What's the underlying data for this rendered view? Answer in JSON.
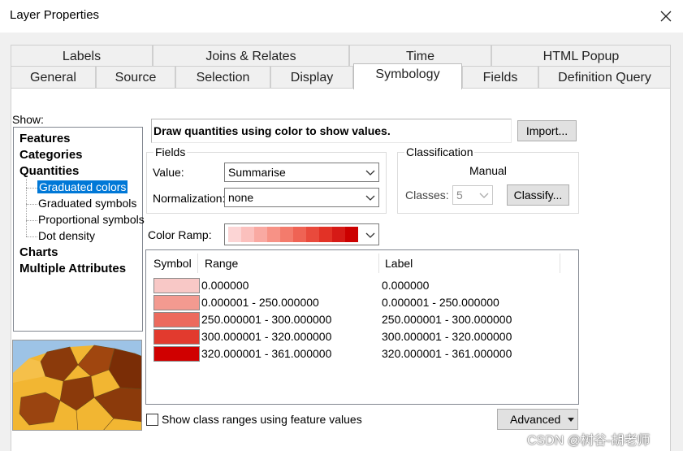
{
  "window": {
    "title": "Layer Properties"
  },
  "tabs_top": [
    "Labels",
    "Joins & Relates",
    "Time",
    "HTML Popup"
  ],
  "tabs_bottom": [
    "General",
    "Source",
    "Selection",
    "Display",
    "Symbology",
    "Fields",
    "Definition Query"
  ],
  "active_tab": "Symbology",
  "show": {
    "label": "Show:",
    "tree": {
      "features": "Features",
      "categories": "Categories",
      "quantities": "Quantities",
      "sub": [
        "Graduated colors",
        "Graduated symbols",
        "Proportional symbols",
        "Dot density"
      ],
      "charts": "Charts",
      "multiple": "Multiple Attributes"
    },
    "selected": "Graduated colors"
  },
  "description": "Draw quantities using color to show values.",
  "import_button": "Import...",
  "fields": {
    "group_title": "Fields",
    "value_label": "Value:",
    "value": "Summarise",
    "normalization_label": "Normalization:",
    "normalization": "none"
  },
  "classification": {
    "group_title": "Classification",
    "method": "Manual",
    "classes_label": "Classes:",
    "classes": "5",
    "classify_button": "Classify..."
  },
  "color_ramp": {
    "label": "Color Ramp:",
    "colors": [
      "#fcd5d5",
      "#fbc0bd",
      "#f9a9a2",
      "#f79286",
      "#f37b6c",
      "#ef6354",
      "#e94a3c",
      "#e23226",
      "#d61a16",
      "#cc0000"
    ]
  },
  "class_table": {
    "headers": {
      "symbol": "Symbol",
      "range": "Range",
      "label": "Label"
    },
    "rows": [
      {
        "color": "#f8c8c6",
        "range": "0.000000",
        "label": "0.000000"
      },
      {
        "color": "#f39a90",
        "range": "0.000001 - 250.000000",
        "label": "0.000001 - 250.000000"
      },
      {
        "color": "#ec6a5d",
        "range": "250.000001 - 300.000000",
        "label": "250.000001 - 300.000000"
      },
      {
        "color": "#e23a2e",
        "range": "300.000001 - 320.000000",
        "label": "300.000001 - 320.000000"
      },
      {
        "color": "#d00000",
        "range": "320.000001 - 361.000000",
        "label": "320.000001 - 361.000000"
      }
    ]
  },
  "show_class_ranges": {
    "label": "Show class ranges using feature values",
    "checked": false
  },
  "advanced_button": "Advanced",
  "watermark": "CSDN @树谷-胡老师"
}
